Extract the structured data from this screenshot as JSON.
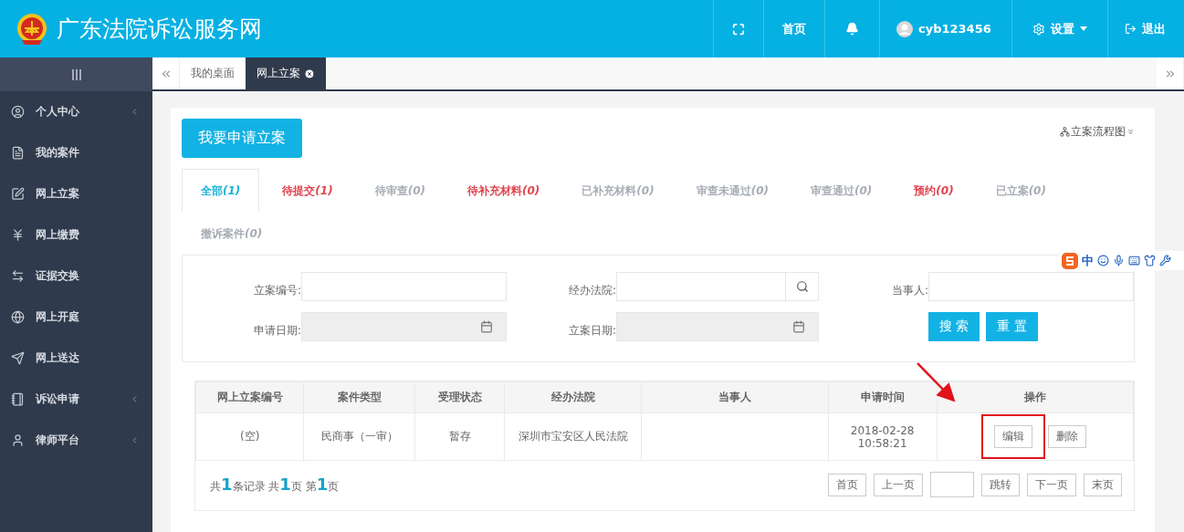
{
  "header": {
    "title": "广东法院诉讼服务网",
    "nav": [
      {
        "kind": "fullscreen"
      },
      {
        "kind": "text",
        "label": "首页"
      },
      {
        "kind": "bell"
      },
      {
        "kind": "user",
        "label": "cyb123456"
      },
      {
        "kind": "settings",
        "label": "设置"
      },
      {
        "kind": "logout",
        "label": "退出"
      }
    ]
  },
  "page_tabs": [
    {
      "label": "我的桌面",
      "selected": false,
      "closable": false
    },
    {
      "label": "网上立案",
      "selected": true,
      "closable": true
    }
  ],
  "sidebar": {
    "items": [
      {
        "label": "个人中心",
        "expandable": true
      },
      {
        "label": "我的案件",
        "expandable": false
      },
      {
        "label": "网上立案",
        "expandable": false
      },
      {
        "label": "网上缴费",
        "expandable": false
      },
      {
        "label": "证据交换",
        "expandable": false
      },
      {
        "label": "网上开庭",
        "expandable": false
      },
      {
        "label": "网上送达",
        "expandable": false
      },
      {
        "label": "诉讼申请",
        "expandable": true
      },
      {
        "label": "律师平台",
        "expandable": true
      }
    ]
  },
  "apply_button": "我要申请立案",
  "flowchart_link": "立案流程图",
  "status_tabs": [
    {
      "label": "全部",
      "count": "(1)",
      "selected": true,
      "color": "#1ab0d8"
    },
    {
      "label": "待提交",
      "count": "(1)",
      "selected": false,
      "color": "#e0454f"
    },
    {
      "label": "待审查",
      "count": "(0)",
      "selected": false,
      "color": "#a7adb5"
    },
    {
      "label": "待补充材料",
      "count": "(0)",
      "selected": false,
      "color": "#e0454f"
    },
    {
      "label": "已补充材料",
      "count": "(0)",
      "selected": false,
      "color": "#a7adb5"
    },
    {
      "label": "审查未通过",
      "count": "(0)",
      "selected": false,
      "color": "#a7adb5"
    },
    {
      "label": "审查通过",
      "count": "(0)",
      "selected": false,
      "color": "#a7adb5"
    },
    {
      "label": "预约",
      "count": "(0)",
      "selected": false,
      "color": "#e0454f"
    },
    {
      "label": "已立案",
      "count": "(0)",
      "selected": false,
      "color": "#a7adb5"
    },
    {
      "label": "撤诉案件",
      "count": "(0)",
      "selected": false,
      "color": "#a7adb5"
    }
  ],
  "filters": [
    {
      "kind": "text",
      "label": "立案编号:"
    },
    {
      "kind": "search",
      "label": "经办法院:"
    },
    {
      "kind": "text",
      "label": "当事人:"
    },
    {
      "kind": "date",
      "label": "申请日期:"
    },
    {
      "kind": "date",
      "label": "立案日期:"
    }
  ],
  "filter_buttons": [
    "搜 索",
    "重 置"
  ],
  "ime_toolbar": {
    "mode": "中"
  },
  "table": {
    "columns": [
      "网上立案编号",
      "案件类型",
      "受理状态",
      "经办法院",
      "当事人",
      "申请时间",
      "操作"
    ],
    "rows": [
      {
        "cells": [
          "(空)",
          "民商事（一审）",
          "暂存",
          "深圳市宝安区人民法院",
          "",
          [
            "2018-02-28",
            "10:58:21"
          ]
        ],
        "actions": [
          {
            "label": "编辑",
            "highlighted": true
          },
          {
            "label": "删除",
            "highlighted": false
          }
        ]
      }
    ]
  },
  "pagination": {
    "summary": "共**1**条记录 共**1**页 第**1**页",
    "buttons_before": [
      "首页",
      "上一页"
    ],
    "jump": "跳转",
    "buttons_after": [
      "下一页",
      "末页"
    ]
  }
}
